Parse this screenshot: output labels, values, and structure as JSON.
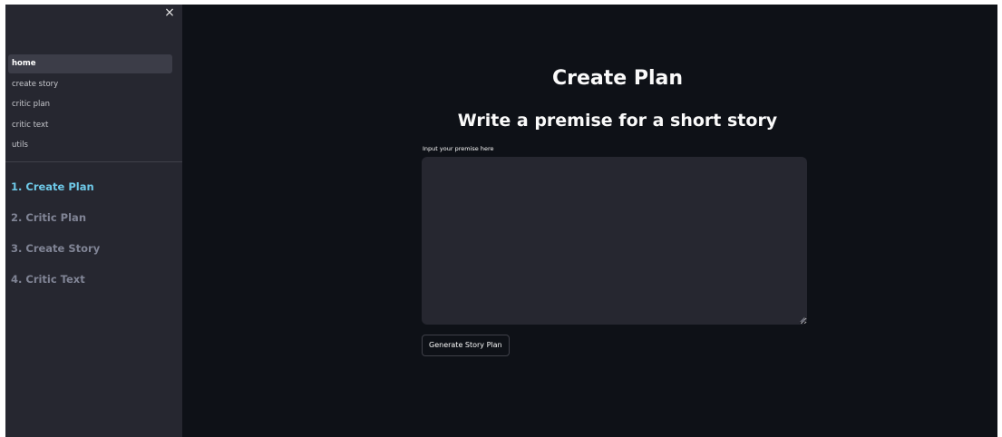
{
  "sidebar": {
    "close_icon": "×",
    "nav_items": [
      {
        "label": "home",
        "active": true
      },
      {
        "label": "create story",
        "active": false
      },
      {
        "label": "critic plan",
        "active": false
      },
      {
        "label": "critic text",
        "active": false
      },
      {
        "label": "utils",
        "active": false
      }
    ],
    "steps": [
      {
        "label": "1. Create Plan",
        "current": true
      },
      {
        "label": "2. Critic Plan",
        "current": false
      },
      {
        "label": "3. Create Story",
        "current": false
      },
      {
        "label": "4. Critic Text",
        "current": false
      }
    ]
  },
  "main": {
    "title": "Create Plan",
    "subtitle": "Write a premise for a short story",
    "premise": {
      "label": "Input your premise here",
      "value": "",
      "placeholder": ""
    },
    "generate_button": "Generate Story Plan"
  },
  "colors": {
    "app_background": "#0e1117",
    "sidebar_background": "#262730",
    "active_step": "#6ec9e8",
    "inactive_step": "#808495"
  },
  "icons": {
    "close": "close-icon",
    "resize": "resize-grip-icon"
  }
}
